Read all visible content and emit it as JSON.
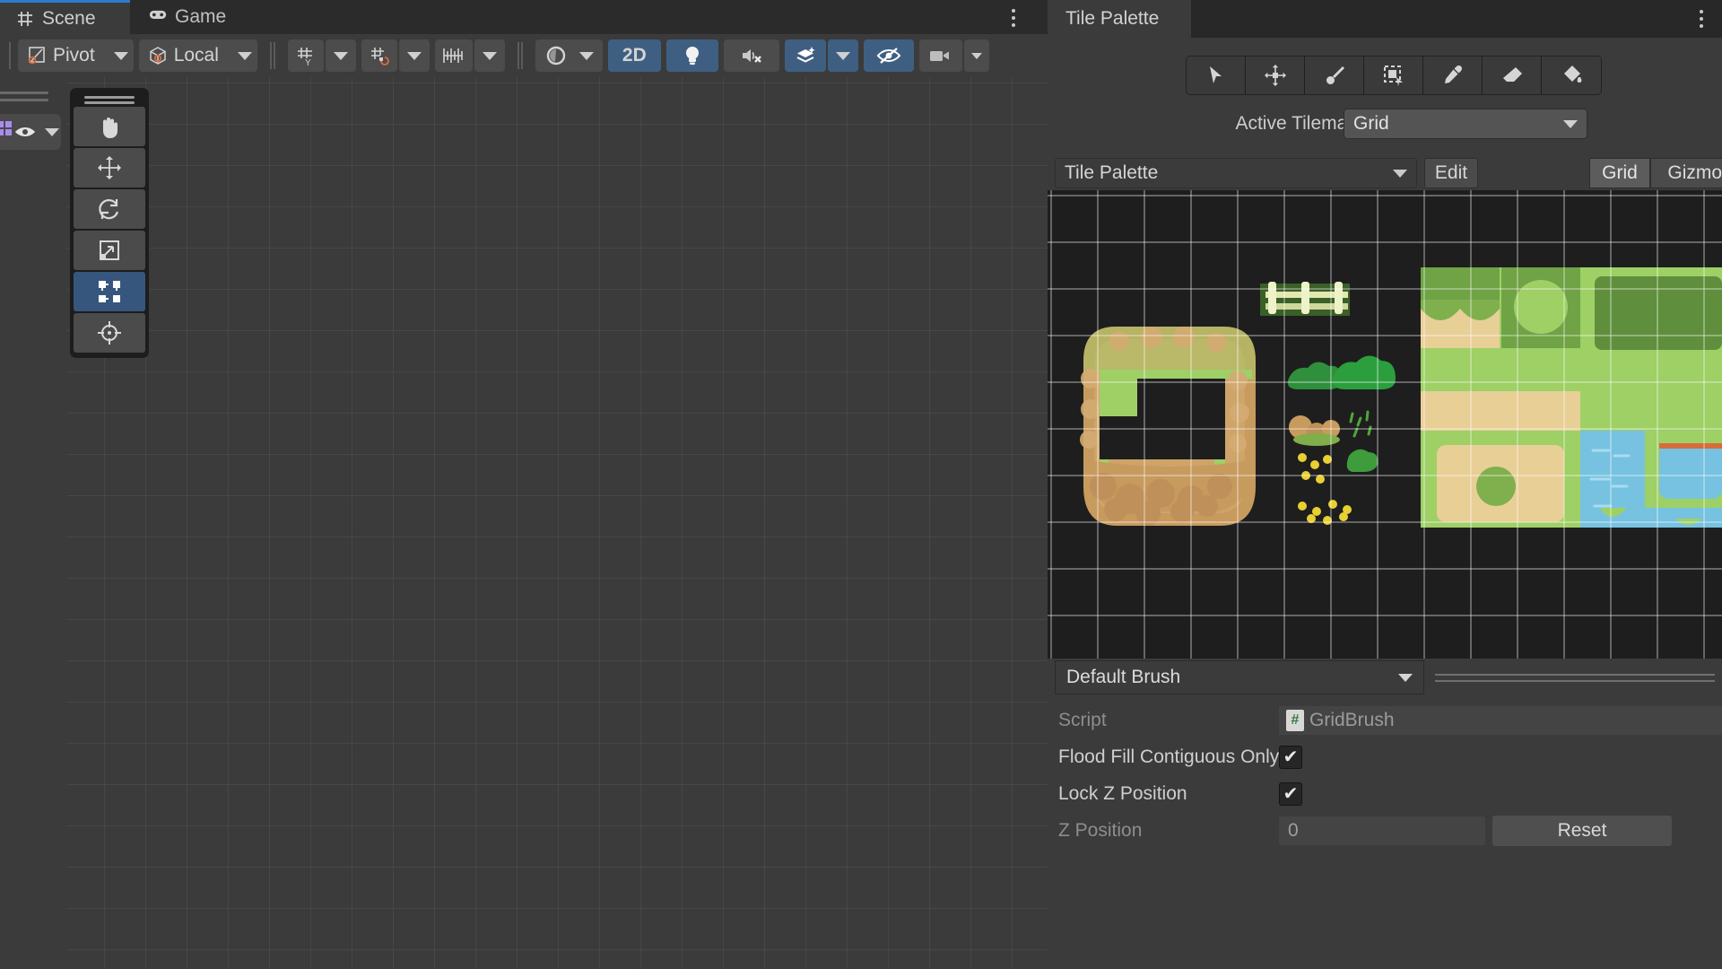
{
  "scene": {
    "tabs": [
      {
        "label": "Scene",
        "icon": "grid-hash-icon",
        "active": true
      },
      {
        "label": "Game",
        "icon": "gamepad-icon",
        "active": false
      }
    ],
    "toolbar": {
      "pivot_label": "Pivot",
      "handle_label": "Local",
      "twod_label": "2D",
      "items": [
        {
          "name": "pivot-dropdown",
          "label": "Pivot",
          "icon": "pivot-icon"
        },
        {
          "name": "handle-rotation-dropdown",
          "label": "Local",
          "icon": "cube-icon"
        },
        {
          "name": "grid-axis-dropdown",
          "label": "",
          "icon": "grid-y-icon"
        },
        {
          "name": "grid-snap-dropdown",
          "label": "",
          "icon": "grid-snap-icon"
        },
        {
          "name": "snap-increment-dropdown",
          "label": "",
          "icon": "ruler-icon"
        },
        {
          "name": "scene-camera-dropdown",
          "label": "",
          "icon": "sphere-icon"
        },
        {
          "name": "toggle-2d",
          "label": "2D",
          "icon": "",
          "active": true
        },
        {
          "name": "toggle-lighting",
          "label": "",
          "icon": "lightbulb-icon",
          "active": true
        },
        {
          "name": "toggle-audio",
          "label": "",
          "icon": "speaker-mute-icon",
          "active": false
        },
        {
          "name": "fx-dropdown",
          "label": "",
          "icon": "fx-layers-icon",
          "active": true
        },
        {
          "name": "toggle-hidden-objects",
          "label": "",
          "icon": "eye-slash-icon",
          "active": true
        },
        {
          "name": "camera-preview-dropdown",
          "label": "",
          "icon": "camera-icon",
          "active": false
        }
      ]
    },
    "overlays": {
      "layers_icon": "layers-visibility-icon",
      "tools": [
        {
          "name": "tool-hand",
          "icon": "hand-icon",
          "selected": false
        },
        {
          "name": "tool-move",
          "icon": "move-icon",
          "selected": false
        },
        {
          "name": "tool-rotate",
          "icon": "rotate-icon",
          "selected": false
        },
        {
          "name": "tool-scale",
          "icon": "scale-icon",
          "selected": false
        },
        {
          "name": "tool-rect",
          "icon": "rect-transform-icon",
          "selected": true
        },
        {
          "name": "tool-transform",
          "icon": "transform-icon",
          "selected": false
        }
      ]
    }
  },
  "palette": {
    "tab_label": "Tile Palette",
    "tools": [
      {
        "name": "palette-tool-select",
        "icon": "arrow-cursor-icon"
      },
      {
        "name": "palette-tool-move",
        "icon": "move-icon"
      },
      {
        "name": "palette-tool-paint",
        "icon": "brush-icon"
      },
      {
        "name": "palette-tool-box-fill",
        "icon": "box-select-icon"
      },
      {
        "name": "palette-tool-picker",
        "icon": "eyedropper-icon"
      },
      {
        "name": "palette-tool-erase",
        "icon": "eraser-icon"
      },
      {
        "name": "palette-tool-fill",
        "icon": "paint-bucket-icon"
      }
    ],
    "active_tilemap_label": "Active Tilemap",
    "active_tilemap_value": "Grid",
    "palette_value": "Tile Palette",
    "edit_label": "Edit",
    "grid_label": "Grid",
    "gizmos_label": "Gizmos",
    "brush_value": "Default Brush",
    "inspector": {
      "script_label": "Script",
      "script_value": "GridBrush",
      "flood_fill_label": "Flood Fill Contiguous Only",
      "flood_fill_checked": "✔",
      "lock_z_label": "Lock Z Position",
      "lock_z_checked": "✔",
      "z_position_label": "Z Position",
      "z_position_value": "0",
      "reset_label": "Reset"
    }
  },
  "colors": {
    "accent_blue": "#3f5f82",
    "panel_bg": "#3b3b3b",
    "tab_bg": "#282828",
    "canvas_bg": "#1e1e1e",
    "grass": "#8dc85a",
    "grass_dark": "#6fa345",
    "sand": "#e8cf96",
    "water": "#76c2e0",
    "dirt": "#c79a5e"
  }
}
